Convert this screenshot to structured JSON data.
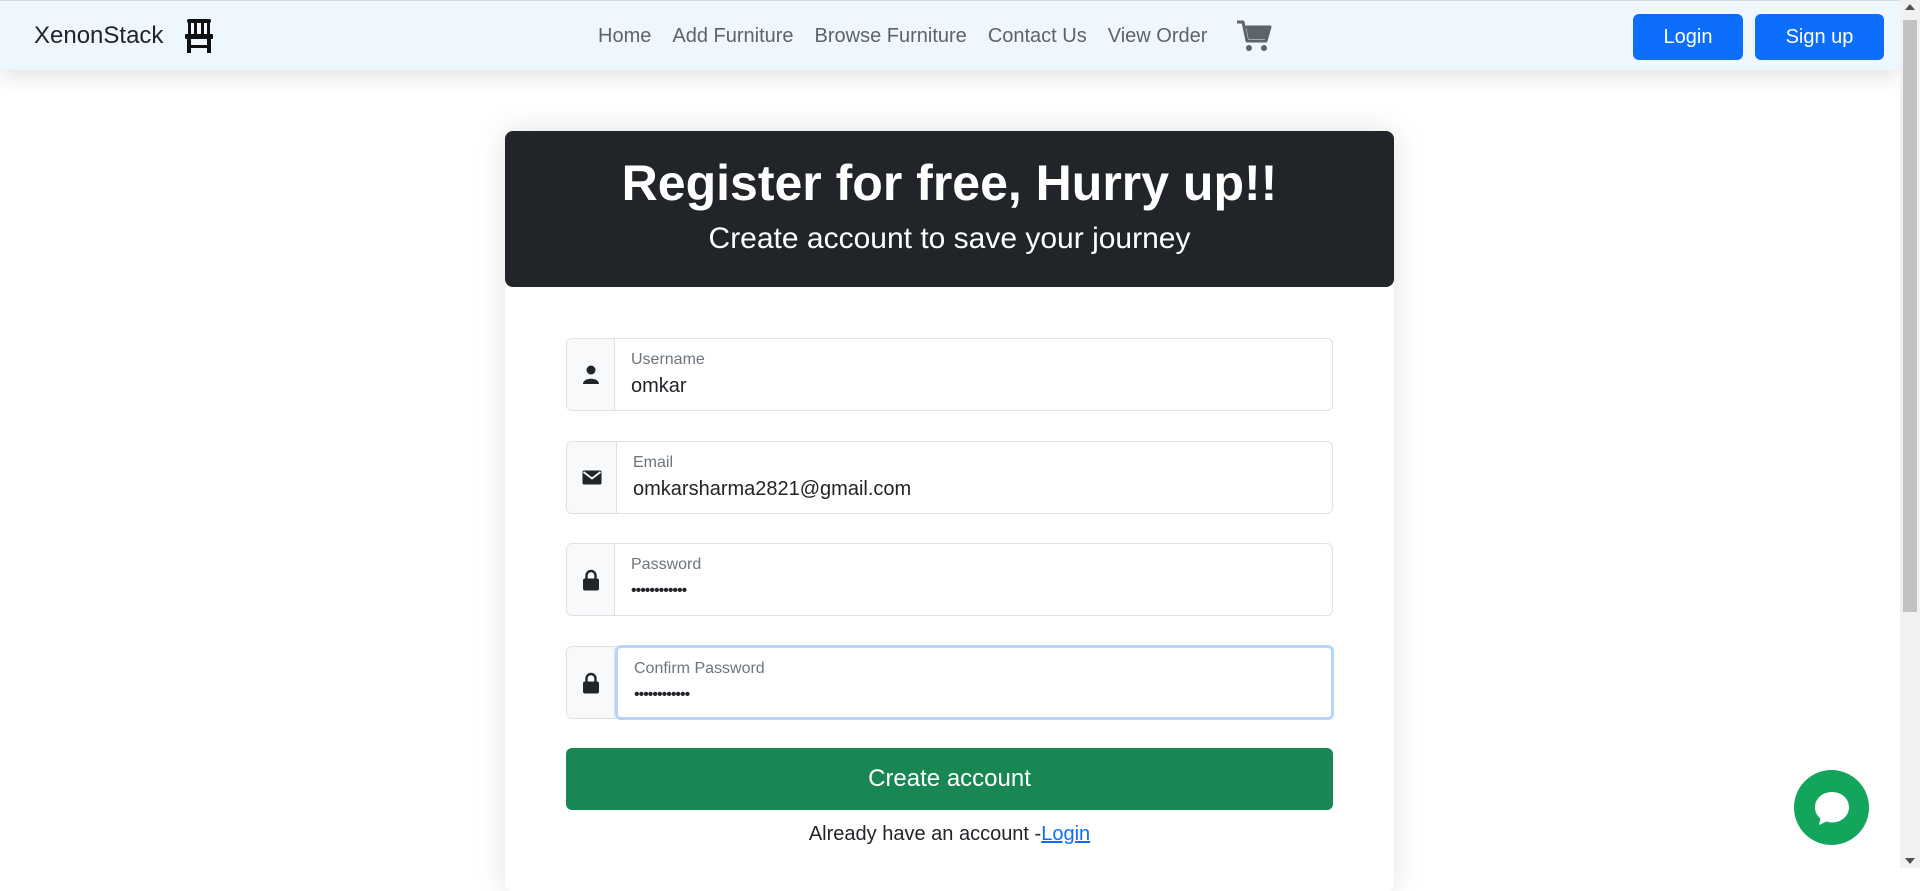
{
  "navbar": {
    "brand": "XenonStack",
    "links": [
      "Home",
      "Add Furniture",
      "Browse Furniture",
      "Contact Us",
      "View Order"
    ],
    "login_label": "Login",
    "signup_label": "Sign up"
  },
  "card": {
    "title": "Register for free, Hurry up!!",
    "subtitle": "Create account to save your journey"
  },
  "form": {
    "username": {
      "label": "Username",
      "value": "omkar"
    },
    "email": {
      "label": "Email",
      "value": "omkarsharma2821@gmail.com"
    },
    "password": {
      "label": "Password",
      "value": "••••••••••••"
    },
    "confirm_password": {
      "label": "Confirm Password",
      "value": "••••••••••••"
    },
    "submit_label": "Create account",
    "already_text": "Already have an account -",
    "login_link": "Login"
  },
  "colors": {
    "navbar_bg": "#eef6fe",
    "primary": "#0d6efd",
    "header_bg": "#212529",
    "success": "#198754",
    "chat": "#13a55c"
  },
  "icons": {
    "brand": "chair-icon",
    "cart": "cart-icon",
    "username": "user-icon",
    "email": "envelope-icon",
    "password": "lock-icon",
    "chat": "chat-bubble-icon"
  }
}
